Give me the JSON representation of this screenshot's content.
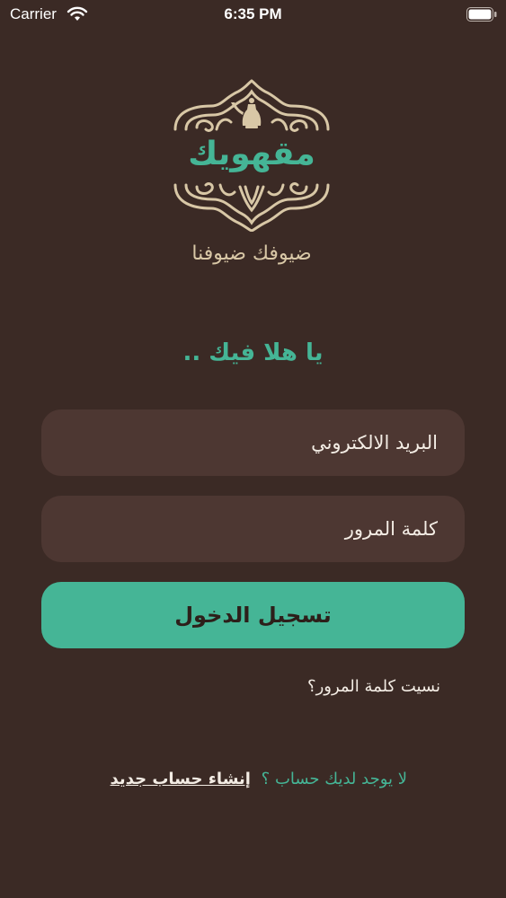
{
  "status_bar": {
    "carrier": "Carrier",
    "time": "6:35 PM"
  },
  "brand": {
    "name": "مقهويك",
    "tagline": "ضيوفك ضيوفنا",
    "accent_color": "#45b596",
    "ornament_color": "#d8c7a6"
  },
  "login": {
    "greeting": "يا هلا فيك ..",
    "email_placeholder": "البريد الالكتروني",
    "email_value": "",
    "password_placeholder": "كلمة المرور",
    "password_value": "",
    "submit_label": "تسجيل الدخول",
    "forgot_password": "نسيت كلمة المرور؟",
    "no_account_text": "لا يوجد لديك حساب ؟",
    "create_account_label": "إنشاء حساب جديد"
  },
  "colors": {
    "background": "#3b2a25",
    "field_background": "#4d3732",
    "button": "#45b596"
  }
}
